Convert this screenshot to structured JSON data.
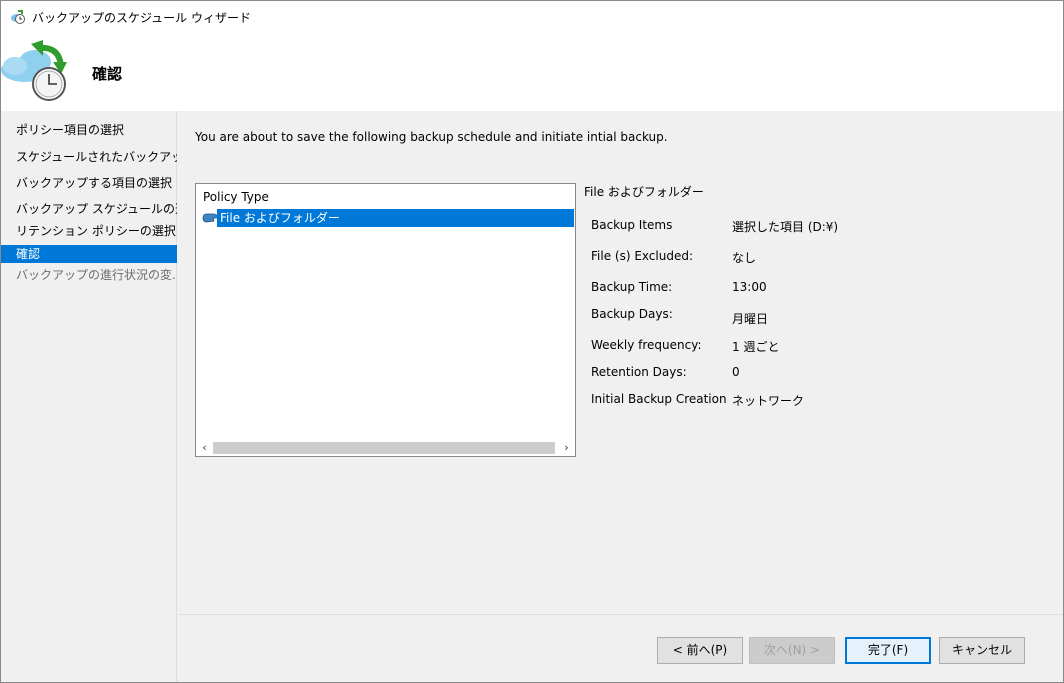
{
  "window": {
    "title": "バックアップのスケジュール ウィザード"
  },
  "header": {
    "title": "確認"
  },
  "nav": {
    "items": [
      {
        "label": "ポリシー項目の選択",
        "state": "normal"
      },
      {
        "label": "スケジュールされたバックアップ...",
        "state": "normal"
      },
      {
        "label": "バックアップする項目の選択",
        "state": "normal"
      },
      {
        "label": "バックアップ スケジュールの選...",
        "state": "normal"
      },
      {
        "label": "リテンション ポリシーの選択 (...",
        "state": "normal"
      },
      {
        "label": "確認",
        "state": "active"
      },
      {
        "label": "バックアップの進行状況の変...",
        "state": "disabled"
      }
    ]
  },
  "main": {
    "intro": "You are about to save the following backup schedule and initiate intial backup.",
    "list": {
      "header": "Policy Type",
      "selected_item": "File およびフォルダー"
    },
    "details": {
      "title": "File およびフォルダー",
      "rows": [
        {
          "label": "Backup Items",
          "value": "選択した項目 (D:¥)"
        },
        {
          "label": "File (s) Excluded:",
          "value": "なし"
        },
        {
          "label": "Backup Time:",
          "value": "13:00"
        },
        {
          "label": "Backup Days:",
          "value": "月曜日"
        },
        {
          "label": "Weekly frequency:",
          "value": "1 週ごと"
        },
        {
          "label": "Retention Days:",
          "value": "0"
        },
        {
          "label": "Initial Backup Creation",
          "value": "ネットワーク"
        }
      ]
    }
  },
  "footer": {
    "back_label": "< 前へ(P)",
    "next_label": "次へ(N) >",
    "finish_label": "完了(F)",
    "cancel_label": "キャンセル"
  },
  "colors": {
    "accent": "#0078d7",
    "background": "#f0f0f0"
  }
}
